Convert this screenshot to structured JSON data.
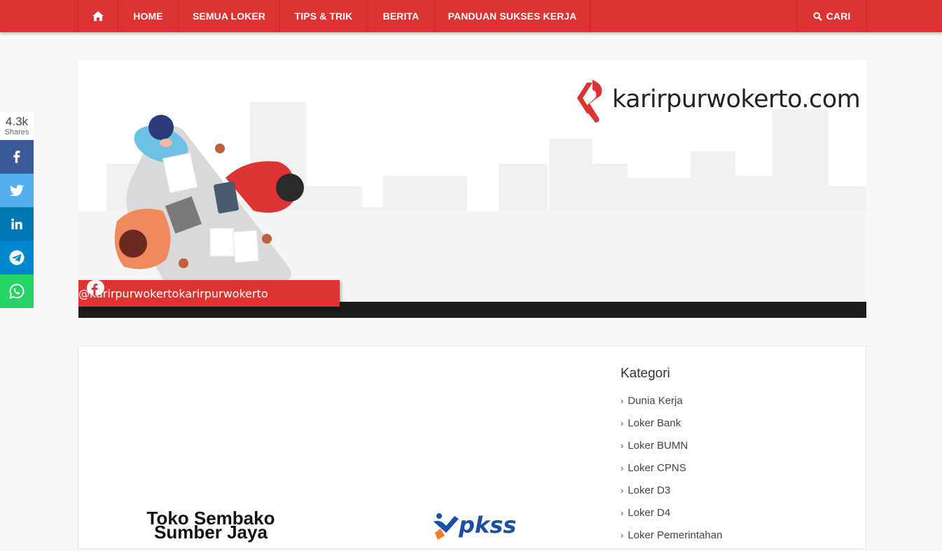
{
  "nav": {
    "home_icon": "home-icon",
    "items": [
      "HOME",
      "SEMUA LOKER",
      "TIPS & TRIK",
      "BERITA",
      "PANDUAN SUKSES KERJA"
    ],
    "search_label": "CARI",
    "color": "#dd3333"
  },
  "share": {
    "count": "4.3k",
    "count_label": "Shares",
    "buttons": [
      {
        "icon": "facebook-icon",
        "color": "#3b5998"
      },
      {
        "icon": "twitter-icon",
        "color": "#55acee"
      },
      {
        "icon": "linkedin-icon",
        "color": "#0077b5"
      },
      {
        "icon": "telegram-icon",
        "color": "#0088cc"
      },
      {
        "icon": "whatsapp-icon",
        "color": "#25d366"
      }
    ]
  },
  "banner": {
    "brand": "karirpurwokerto.com",
    "instagram_handle": "@karirpurwokerto",
    "facebook_handle": "karirpurwokerto"
  },
  "sidebar": {
    "title": "Kategori",
    "categories": [
      "Dunia Kerja",
      "Loker Bank",
      "Loker BUMN",
      "Loker CPNS",
      "Loker D3",
      "Loker D4",
      "Loker Pemerintahan"
    ]
  },
  "ads": {
    "ad1_line1": "Toko Sembako",
    "ad1_line2": "Sumber Jaya",
    "ad2_text": "pkss"
  }
}
